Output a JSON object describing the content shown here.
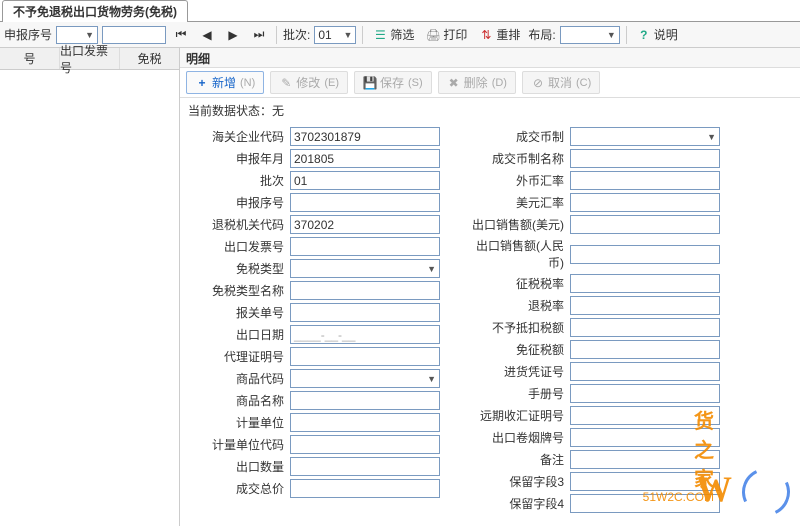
{
  "tab": {
    "title": "不予免退税出口货物劳务(免税)"
  },
  "toolbar1": {
    "seq_label": "申报序号",
    "seq_value": "",
    "batch_label": "批次:",
    "batch_value": "01",
    "filter_label": "筛选",
    "print_label": "打印",
    "rearrange_label": "重排",
    "layout_label": "布局:",
    "help_label": "说明"
  },
  "left_header": {
    "col1": "号",
    "col2": "出口发票号",
    "col3": "免税"
  },
  "right_title": "明细",
  "toolbar2": {
    "add": "新增",
    "add_key": "(N)",
    "edit": "修改",
    "edit_key": "(E)",
    "save": "保存",
    "save_key": "(S)",
    "delete": "删除",
    "delete_key": "(D)",
    "cancel": "取消",
    "cancel_key": "(C)"
  },
  "status": {
    "label": "当前数据状态：",
    "value": "无"
  },
  "fields_left": [
    {
      "label": "海关企业代码",
      "value": "3702301879",
      "combo": false
    },
    {
      "label": "申报年月",
      "value": "201805",
      "combo": false
    },
    {
      "label": "批次",
      "value": "01",
      "combo": false
    },
    {
      "label": "申报序号",
      "value": "",
      "combo": false
    },
    {
      "label": "退税机关代码",
      "value": "370202",
      "combo": false
    },
    {
      "label": "出口发票号",
      "value": "",
      "combo": false
    },
    {
      "label": "免税类型",
      "value": "",
      "combo": true
    },
    {
      "label": "免税类型名称",
      "value": "",
      "combo": false
    },
    {
      "label": "报关单号",
      "value": "",
      "combo": false
    },
    {
      "label": "出口日期",
      "value": "____-__-__",
      "combo": false
    },
    {
      "label": "代理证明号",
      "value": "",
      "combo": false
    },
    {
      "label": "商品代码",
      "value": "",
      "combo": true
    },
    {
      "label": "商品名称",
      "value": "",
      "combo": false
    },
    {
      "label": "计量单位",
      "value": "",
      "combo": false
    },
    {
      "label": "计量单位代码",
      "value": "",
      "combo": false
    },
    {
      "label": "出口数量",
      "value": "",
      "combo": false
    },
    {
      "label": "成交总价",
      "value": "",
      "combo": false
    }
  ],
  "fields_right": [
    {
      "label": "成交币制",
      "value": "",
      "combo": true
    },
    {
      "label": "成交币制名称",
      "value": "",
      "combo": false
    },
    {
      "label": "外币汇率",
      "value": "",
      "combo": false
    },
    {
      "label": "美元汇率",
      "value": "",
      "combo": false
    },
    {
      "label": "出口销售额(美元)",
      "value": "",
      "combo": false
    },
    {
      "label": "出口销售额(人民币)",
      "value": "",
      "combo": false
    },
    {
      "label": "征税税率",
      "value": "",
      "combo": false
    },
    {
      "label": "退税率",
      "value": "",
      "combo": false
    },
    {
      "label": "不予抵扣税额",
      "value": "",
      "combo": false
    },
    {
      "label": "免征税额",
      "value": "",
      "combo": false
    },
    {
      "label": "进货凭证号",
      "value": "",
      "combo": false
    },
    {
      "label": "手册号",
      "value": "",
      "combo": false
    },
    {
      "label": "远期收汇证明号",
      "value": "",
      "combo": false
    },
    {
      "label": "出口卷烟牌号",
      "value": "",
      "combo": false
    },
    {
      "label": "备注",
      "value": "",
      "combo": false
    },
    {
      "label": "保留字段3",
      "value": "",
      "combo": false
    },
    {
      "label": "保留字段4",
      "value": "",
      "combo": false
    }
  ],
  "watermark": {
    "brand": "货之家",
    "domain": "51W2C.COM"
  }
}
